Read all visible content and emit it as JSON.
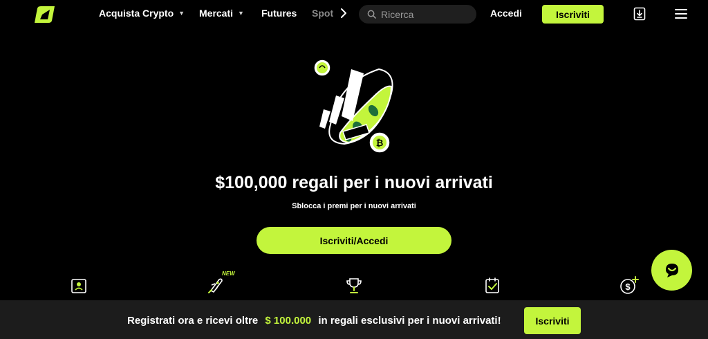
{
  "header": {
    "nav": [
      {
        "label": "Acquista Crypto",
        "has_dropdown": true
      },
      {
        "label": "Mercati",
        "has_dropdown": true
      },
      {
        "label": "Futures",
        "has_dropdown": false
      },
      {
        "label": "Spot",
        "has_dropdown": false
      }
    ],
    "search_placeholder": "Ricerca",
    "login_label": "Accedi",
    "signup_label": "Iscriviti",
    "icons": [
      "logo",
      "chevron-right-icon",
      "search-icon",
      "download-app-icon",
      "hamburger-menu-icon"
    ]
  },
  "hero": {
    "title": "$100,000 regali per i nuovi arrivati",
    "subtitle": "Sblocca i premi per i nuovi arrivati",
    "cta_label": "Iscriviti/Accedi"
  },
  "features": {
    "icons": [
      "id-card-icon",
      "rocket-icon",
      "trophy-icon",
      "clipboard-check-icon",
      "dollar-plus-icon"
    ],
    "new_badge": "NEW"
  },
  "chat": {
    "icon": "chat-icon"
  },
  "banner": {
    "text_before": "Registrati ora e ricevi oltre",
    "amount": "$ 100.000",
    "text_after": "in regali esclusivi per i nuovi arrivati!",
    "button_label": "Iscriviti"
  },
  "colors": {
    "accent": "#c3f53c",
    "background": "#000000",
    "banner": "#1c1c1c",
    "search_bg": "#1f1f1f"
  }
}
